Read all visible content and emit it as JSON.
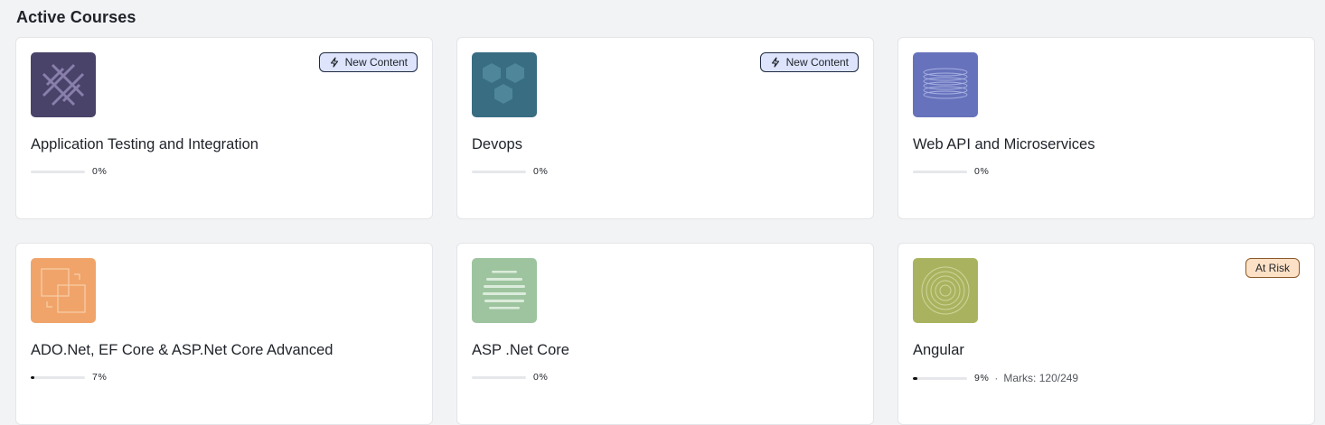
{
  "section": {
    "title": "Active Courses"
  },
  "courses": [
    {
      "title": "Application Testing and Integration",
      "badge": "New Content",
      "badge_type": "new",
      "progress_label": "0%",
      "progress_fraction": 0.0,
      "thumb_color": "#4a4369",
      "thumb_icon": "crossed-lines-icon"
    },
    {
      "title": "Devops",
      "badge": "New Content",
      "badge_type": "new",
      "progress_label": "0%",
      "progress_fraction": 0.0,
      "thumb_color": "#386d82",
      "thumb_icon": "hexagons-icon"
    },
    {
      "title": "Web API and Microservices",
      "badge": "",
      "badge_type": "",
      "progress_label": "0%",
      "progress_fraction": 0.0,
      "thumb_color": "#6672bb",
      "thumb_icon": "stacked-rings-icon"
    },
    {
      "title": "ADO.Net, EF Core & ASP.Net Core Advanced",
      "badge": "",
      "badge_type": "",
      "progress_label": "7%",
      "progress_fraction": 0.07,
      "thumb_color": "#f0a46a",
      "thumb_icon": "overlapping-squares-icon"
    },
    {
      "title": "ASP .Net Core",
      "badge": "",
      "badge_type": "",
      "progress_label": "0%",
      "progress_fraction": 0.0,
      "thumb_color": "#9dc49e",
      "thumb_icon": "striped-circle-icon"
    },
    {
      "title": "Angular",
      "badge": "At Risk",
      "badge_type": "risk",
      "progress_label": "9%",
      "progress_fraction": 0.09,
      "separator": "·",
      "marks": "Marks: 120/249",
      "thumb_color": "#a9b35f",
      "thumb_icon": "concentric-circles-icon"
    }
  ]
}
